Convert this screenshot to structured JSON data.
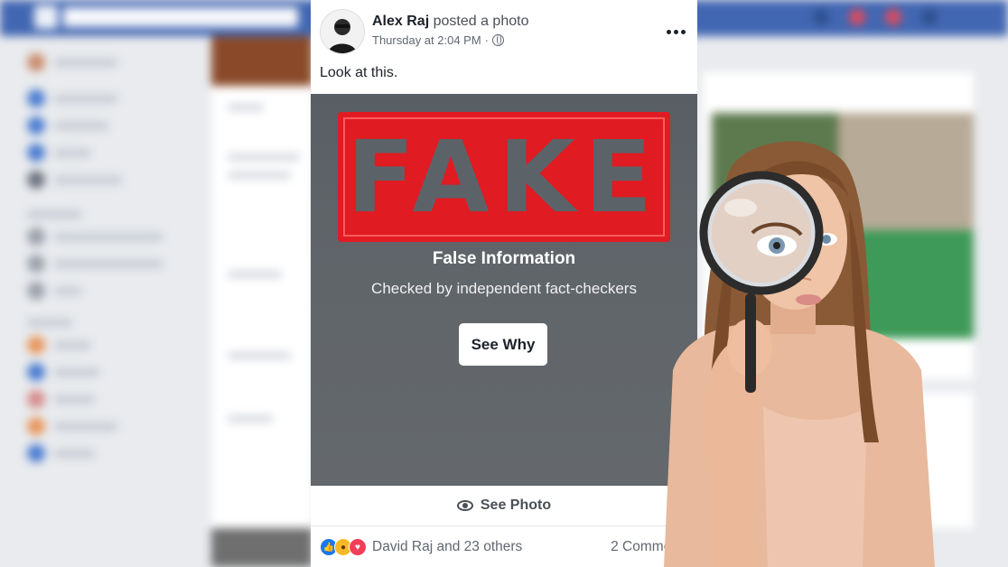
{
  "post": {
    "author": "Alex Raj",
    "action": "posted a photo",
    "timestamp": "Thursday at 2:04 PM",
    "separator": "·",
    "text": "Look at this.",
    "overlay": {
      "stamp": "FAKE",
      "title": "False Information",
      "subtitle": "Checked by independent fact-checkers",
      "see_why": "See Why"
    },
    "see_photo": "See Photo",
    "reactions": {
      "summary": "David Raj and 23 others",
      "comments": "2 Comments"
    }
  },
  "colors": {
    "facebook_blue": "#4267b2",
    "stamp_red": "#e11b22",
    "overlay_gray": "#5f6469"
  }
}
